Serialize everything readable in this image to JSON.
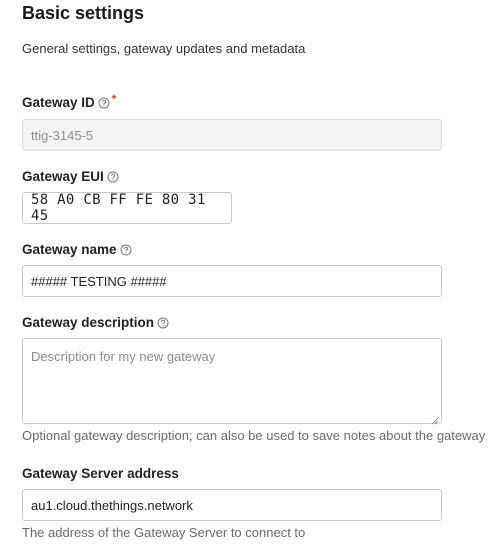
{
  "section": {
    "title": "Basic settings",
    "subtitle": "General settings, gateway updates and metadata"
  },
  "fields": {
    "gateway_id": {
      "label": "Gateway ID",
      "required_mark": "*",
      "value": "ttig-3145-5"
    },
    "gateway_eui": {
      "label": "Gateway EUI",
      "value": "58 A0 CB FF FE 80 31 45"
    },
    "gateway_name": {
      "label": "Gateway name",
      "value": "##### TESTING #####"
    },
    "gateway_description": {
      "label": "Gateway description",
      "placeholder": "Description for my new gateway",
      "hint": "Optional gateway description; can also be used to save notes about the gateway"
    },
    "gateway_server_address": {
      "label": "Gateway Server address",
      "value": "au1.cloud.thethings.network",
      "hint": "The address of the Gateway Server to connect to"
    }
  },
  "icons": {
    "help": "help-circle-icon"
  },
  "colors": {
    "required": "#d43b3b",
    "border": "#c9c9c9",
    "disabled_bg": "#f4f4f4"
  }
}
